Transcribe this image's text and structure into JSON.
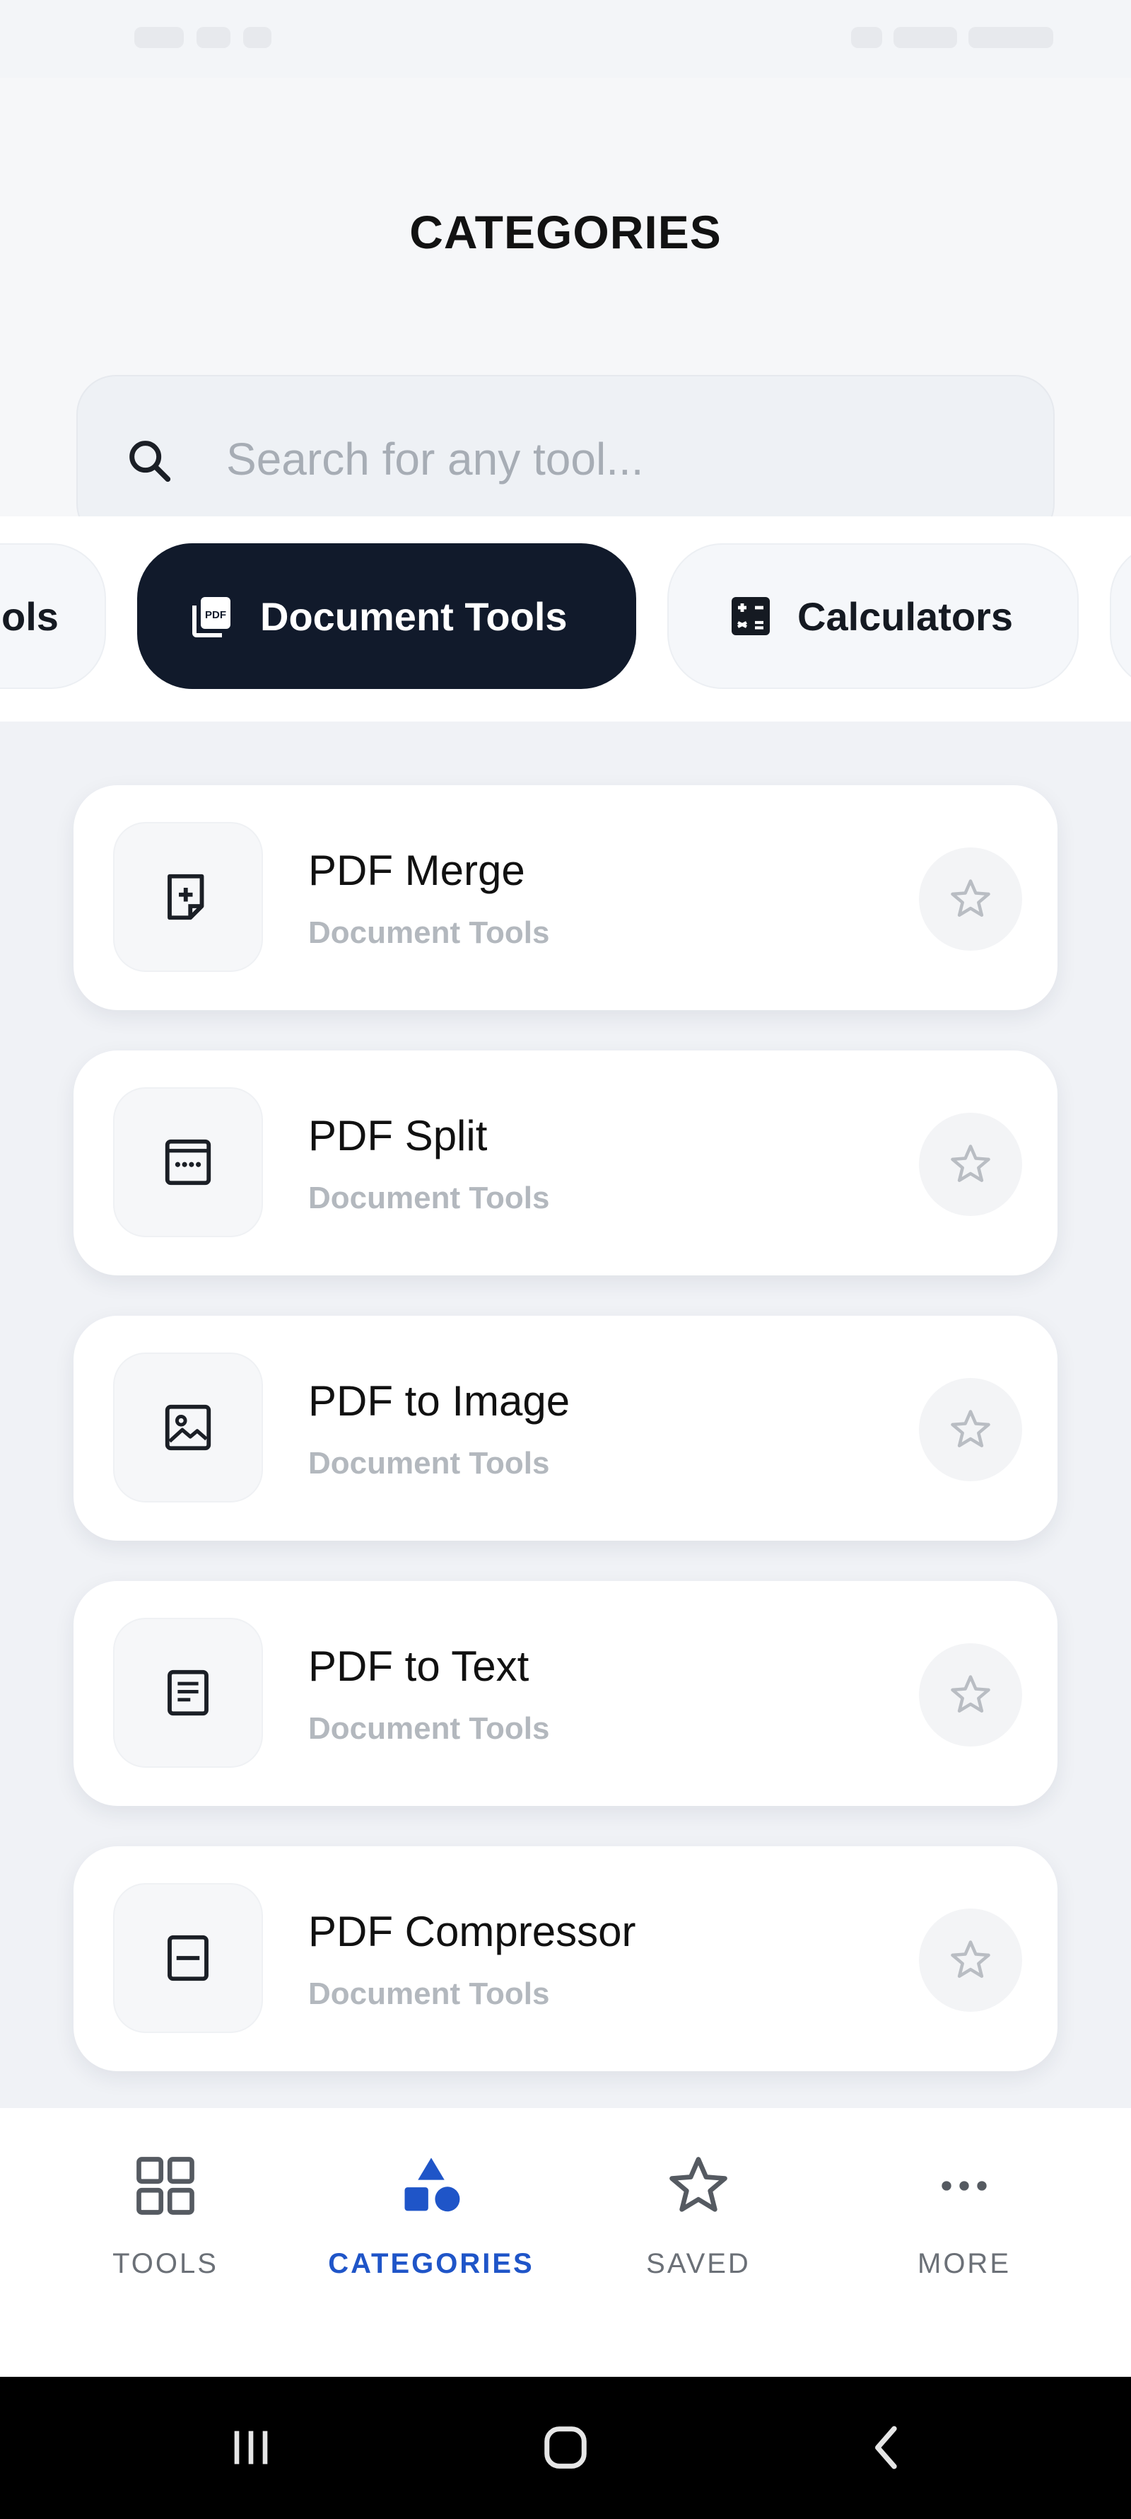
{
  "header": {
    "title": "CATEGORIES",
    "search_placeholder": "Search for any tool..."
  },
  "chips": [
    {
      "label": "ols",
      "icon": "wrench-icon",
      "active": false
    },
    {
      "label": "Document Tools",
      "icon": "pdf-document-icon",
      "active": true
    },
    {
      "label": "Calculators",
      "icon": "calculator-icon",
      "active": false
    }
  ],
  "tools": [
    {
      "title": "PDF Merge",
      "category": "Document Tools",
      "icon": "file-plus-icon"
    },
    {
      "title": "PDF Split",
      "category": "Document Tools",
      "icon": "split-dots-icon"
    },
    {
      "title": "PDF to Image",
      "category": "Document Tools",
      "icon": "image-icon"
    },
    {
      "title": "PDF to Text",
      "category": "Document Tools",
      "icon": "text-document-icon"
    },
    {
      "title": "PDF Compressor",
      "category": "Document Tools",
      "icon": "compress-icon"
    }
  ],
  "bottom_nav": [
    {
      "label": "TOOLS",
      "icon": "grid-icon",
      "active": false
    },
    {
      "label": "CATEGORIES",
      "icon": "shapes-icon",
      "active": true
    },
    {
      "label": "SAVED",
      "icon": "star-icon",
      "active": false
    },
    {
      "label": "MORE",
      "icon": "more-dots-icon",
      "active": false
    }
  ],
  "colors": {
    "accent": "#1f55c8",
    "chip_active_bg": "#111a2b",
    "subtitle_gray": "#b3b8be"
  }
}
